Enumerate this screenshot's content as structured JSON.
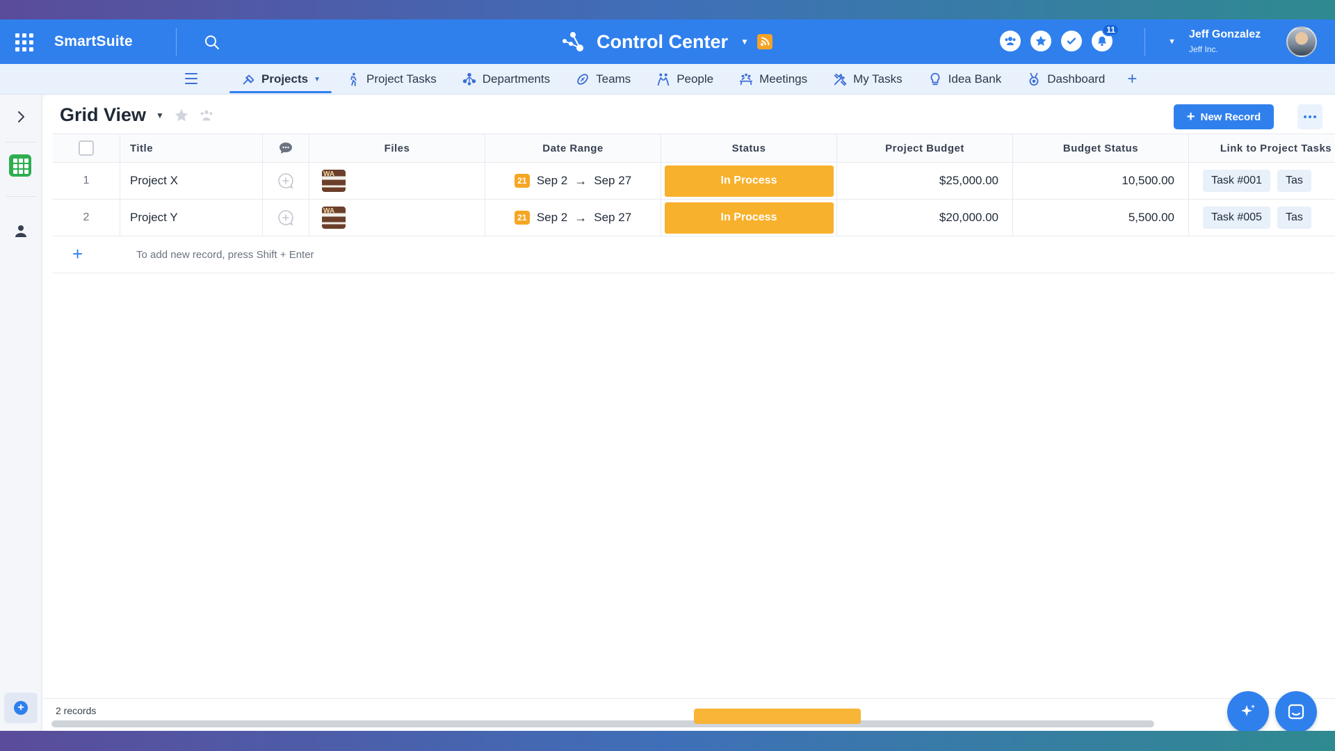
{
  "app": {
    "brand": "SmartSuite",
    "workspace_title": "Control Center",
    "accent_color": "#2f80ed",
    "status_color": "#f8b12c"
  },
  "topbar": {
    "notification_count": "11",
    "user_name": "Jeff Gonzalez",
    "user_org": "Jeff Inc.",
    "icons": [
      "apps-grid-icon",
      "search-icon",
      "members-icon",
      "favorites-star-icon",
      "check-icon",
      "bell-icon"
    ]
  },
  "tabs": [
    {
      "label": "Projects",
      "icon": "projects-icon",
      "active": true
    },
    {
      "label": "Project Tasks",
      "icon": "person-walking-icon"
    },
    {
      "label": "Departments",
      "icon": "org-chart-icon"
    },
    {
      "label": "Teams",
      "icon": "football-icon"
    },
    {
      "label": "People",
      "icon": "people-icon"
    },
    {
      "label": "Meetings",
      "icon": "meeting-icon"
    },
    {
      "label": "My Tasks",
      "icon": "tools-icon"
    },
    {
      "label": "Idea Bank",
      "icon": "lightbulb-icon"
    },
    {
      "label": "Dashboard",
      "icon": "medal-icon"
    }
  ],
  "view": {
    "title": "Grid View",
    "new_record_label": "New Record"
  },
  "grid": {
    "columns": [
      "Title",
      "Files",
      "Date Range",
      "Status",
      "Project Budget",
      "Budget Status",
      "Link to Project Tasks"
    ],
    "rows": [
      {
        "num": "1",
        "title": "Project X",
        "date_start": "Sep 2",
        "date_end": "Sep 27",
        "date_chip": "21",
        "status": "In Process",
        "budget": "$25,000.00",
        "budget_status": "10,500.00",
        "link1": "Task #001",
        "link2": "Tas"
      },
      {
        "num": "2",
        "title": "Project Y",
        "date_start": "Sep 2",
        "date_end": "Sep 27",
        "date_chip": "21",
        "status": "In Process",
        "budget": "$20,000.00",
        "budget_status": "5,500.00",
        "link1": "Task #005",
        "link2": "Tas"
      }
    ],
    "add_hint": "To add new record, press Shift + Enter"
  },
  "footer": {
    "records_label": "2 records"
  }
}
